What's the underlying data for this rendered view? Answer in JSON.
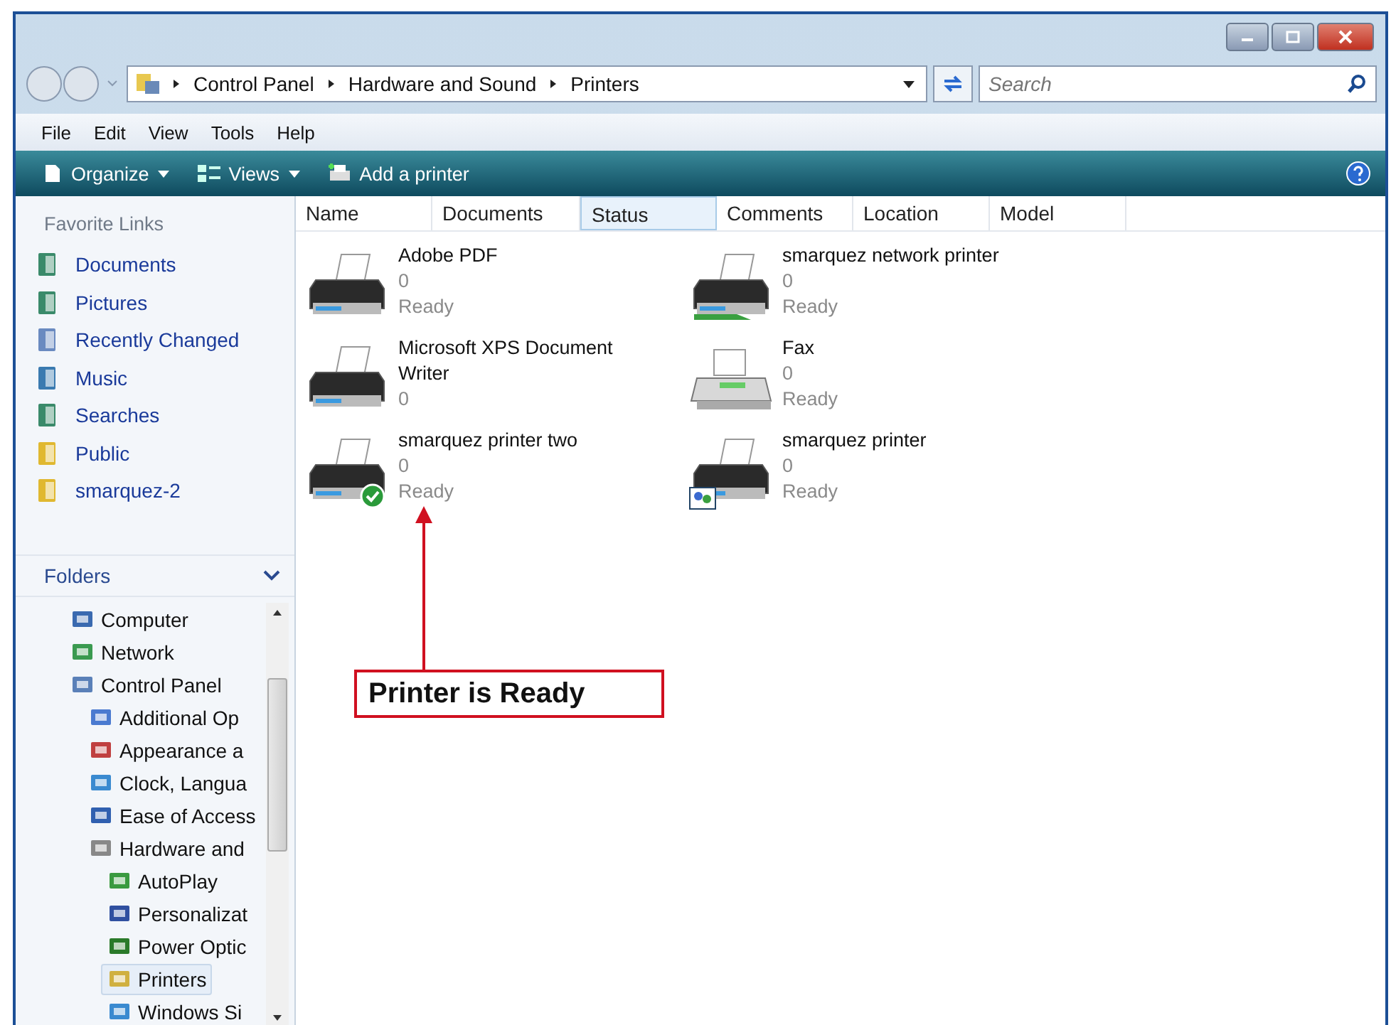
{
  "address_bar": {
    "crumbs": [
      "Control Panel",
      "Hardware and Sound",
      "Printers"
    ]
  },
  "search": {
    "placeholder": "Search"
  },
  "menu": [
    "File",
    "Edit",
    "View",
    "Tools",
    "Help"
  ],
  "toolbar": [
    {
      "kind": "organize",
      "label": "Organize"
    },
    {
      "kind": "views",
      "label": "Views"
    },
    {
      "kind": "add",
      "label": "Add a printer"
    }
  ],
  "favorite_links": {
    "title": "Favorite Links",
    "items": [
      {
        "label": "Documents",
        "kind": "documents"
      },
      {
        "label": "Pictures",
        "kind": "pictures"
      },
      {
        "label": "Recently Changed",
        "kind": "recent"
      },
      {
        "label": "Music",
        "kind": "music"
      },
      {
        "label": "Searches",
        "kind": "searches"
      },
      {
        "label": "Public",
        "kind": "folder"
      },
      {
        "label": "smarquez-2",
        "kind": "folder"
      }
    ]
  },
  "folders": {
    "title": "Folders",
    "items": [
      {
        "label": "Computer",
        "kind": "computer",
        "selected": false
      },
      {
        "label": "Network",
        "kind": "network",
        "selected": false
      },
      {
        "label": "Control Panel",
        "kind": "panel",
        "selected": false,
        "children": [
          {
            "label": "Additional Op",
            "kind": "check",
            "selected": false
          },
          {
            "label": "Appearance a",
            "kind": "appearance",
            "selected": false
          },
          {
            "label": "Clock, Langua",
            "kind": "globe",
            "selected": false
          },
          {
            "label": "Ease of Access",
            "kind": "ease",
            "selected": false
          },
          {
            "label": "Hardware and",
            "kind": "hardware",
            "selected": false,
            "children": [
              {
                "label": "AutoPlay",
                "kind": "autoplay",
                "selected": false
              },
              {
                "label": "Personalizat",
                "kind": "monitor",
                "selected": false
              },
              {
                "label": "Power Optic",
                "kind": "power",
                "selected": false
              },
              {
                "label": "Printers",
                "kind": "printers",
                "selected": true
              },
              {
                "label": "Windows Si",
                "kind": "globe",
                "selected": false
              }
            ]
          }
        ]
      }
    ]
  },
  "columns": [
    {
      "label": "Name",
      "selected": false
    },
    {
      "label": "Documents",
      "selected": false
    },
    {
      "label": "Status",
      "selected": true
    },
    {
      "label": "Comments",
      "selected": false
    },
    {
      "label": "Location",
      "selected": false
    },
    {
      "label": "Model",
      "selected": false
    }
  ],
  "printers": [
    {
      "name": "Adobe PDF",
      "documents": "0",
      "status": "Ready",
      "kind": "printer",
      "default": false
    },
    {
      "name": "smarquez network printer",
      "documents": "0",
      "status": "Ready",
      "kind": "network",
      "default": false
    },
    {
      "name": "Microsoft XPS Document Writer",
      "documents": "0",
      "kind": "printer",
      "default": false
    },
    {
      "name": "Fax",
      "documents": "0",
      "status": "Ready",
      "kind": "fax",
      "default": false
    },
    {
      "name": "smarquez printer two",
      "documents": "0",
      "status": "Ready",
      "kind": "printer",
      "default": true
    },
    {
      "name": "smarquez printer",
      "documents": "0",
      "status": "Ready",
      "kind": "shared",
      "default": false
    }
  ],
  "callout": {
    "text": "Printer is Ready"
  }
}
